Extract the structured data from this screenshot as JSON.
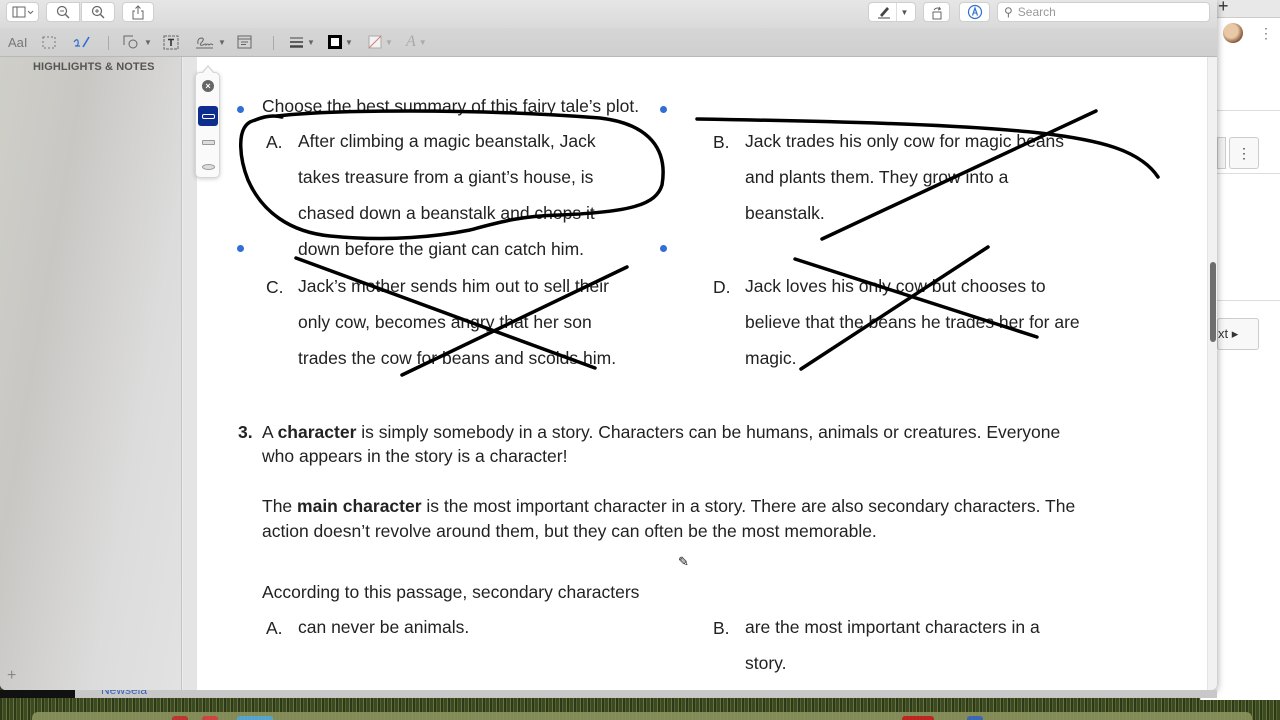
{
  "app": {
    "toolbar_top": {
      "sidebar_toggle_icon": "sidebar-icon",
      "zoom_out_icon": "zoom-out-icon",
      "zoom_in_icon": "zoom-in-icon",
      "share_icon": "share-icon",
      "markup_pen_icon": "pen-icon",
      "rotate_icon": "rotate-icon",
      "markup_toolbar_icon": "markup-icon",
      "search_placeholder": "Search",
      "search_value": ""
    },
    "toolbar_markup": {
      "text_selection_label": "AaI",
      "tools": [
        "text-selection",
        "rectangular-selection",
        "sketch",
        "shapes",
        "text-box",
        "signature",
        "note",
        "line-style",
        "border-color",
        "fill-color",
        "text-style"
      ],
      "border_color": "#000000",
      "sketch_color": "#2f6fd6"
    },
    "sidebar": {
      "title": "HIGHLIGHTS & NOTES",
      "add_label": "+"
    },
    "shape_style_popover": {
      "options": [
        "close",
        "rounded-rect",
        "rect",
        "oval"
      ],
      "selected": "rounded-rect",
      "selected_color": "#0c2f8f"
    },
    "scrollbar": {
      "position_fraction": 0.36
    }
  },
  "document": {
    "q2": {
      "prompt": "Choose the best summary of this fairy tale’s plot.",
      "options": [
        {
          "letter": "A.",
          "lines": [
            "After climbing a magic beanstalk, Jack",
            "takes treasure from a giant’s house, is",
            "chased down a beanstalk and chops it",
            "down before the giant can catch him."
          ],
          "annotation": "circled"
        },
        {
          "letter": "B.",
          "lines": [
            "Jack trades his only cow for magic beans",
            "and plants them. They grow into a",
            "beanstalk."
          ],
          "annotation": "crossed-out"
        },
        {
          "letter": "C.",
          "lines": [
            "Jack’s mother sends him out to sell their",
            "only cow, becomes angry that her son",
            "trades the cow for beans and scolds him."
          ],
          "annotation": "crossed-out"
        },
        {
          "letter": "D.",
          "lines": [
            "Jack loves his only cow but chooses to",
            "believe that the beans he trades her for are",
            "magic."
          ],
          "annotation": "crossed-out"
        }
      ]
    },
    "q3": {
      "number": "3.",
      "p1_pre": "A ",
      "p1_bold": "character",
      "p1_post": " is simply somebody in a story. Characters can be humans, animals or creatures. Everyone",
      "p1_line2": "who appears in the story is a character!",
      "p2_pre": "The ",
      "p2_bold": "main character",
      "p2_post": " is the most important character in a story. There are also secondary characters. The",
      "p2_line2": "action doesn’t revolve around them, but they can often be the most memorable.",
      "prompt": "According to this passage, secondary characters",
      "options": [
        {
          "letter": "A.",
          "lines": [
            "can never be animals."
          ]
        },
        {
          "letter": "B.",
          "lines": [
            "are the most important characters in a",
            "story."
          ]
        }
      ]
    }
  },
  "background_window": {
    "new_tab_label": "+",
    "more_label": "⋮",
    "next_label": "xt ▸"
  },
  "taskbar": {
    "tab_label": "Newsela"
  }
}
